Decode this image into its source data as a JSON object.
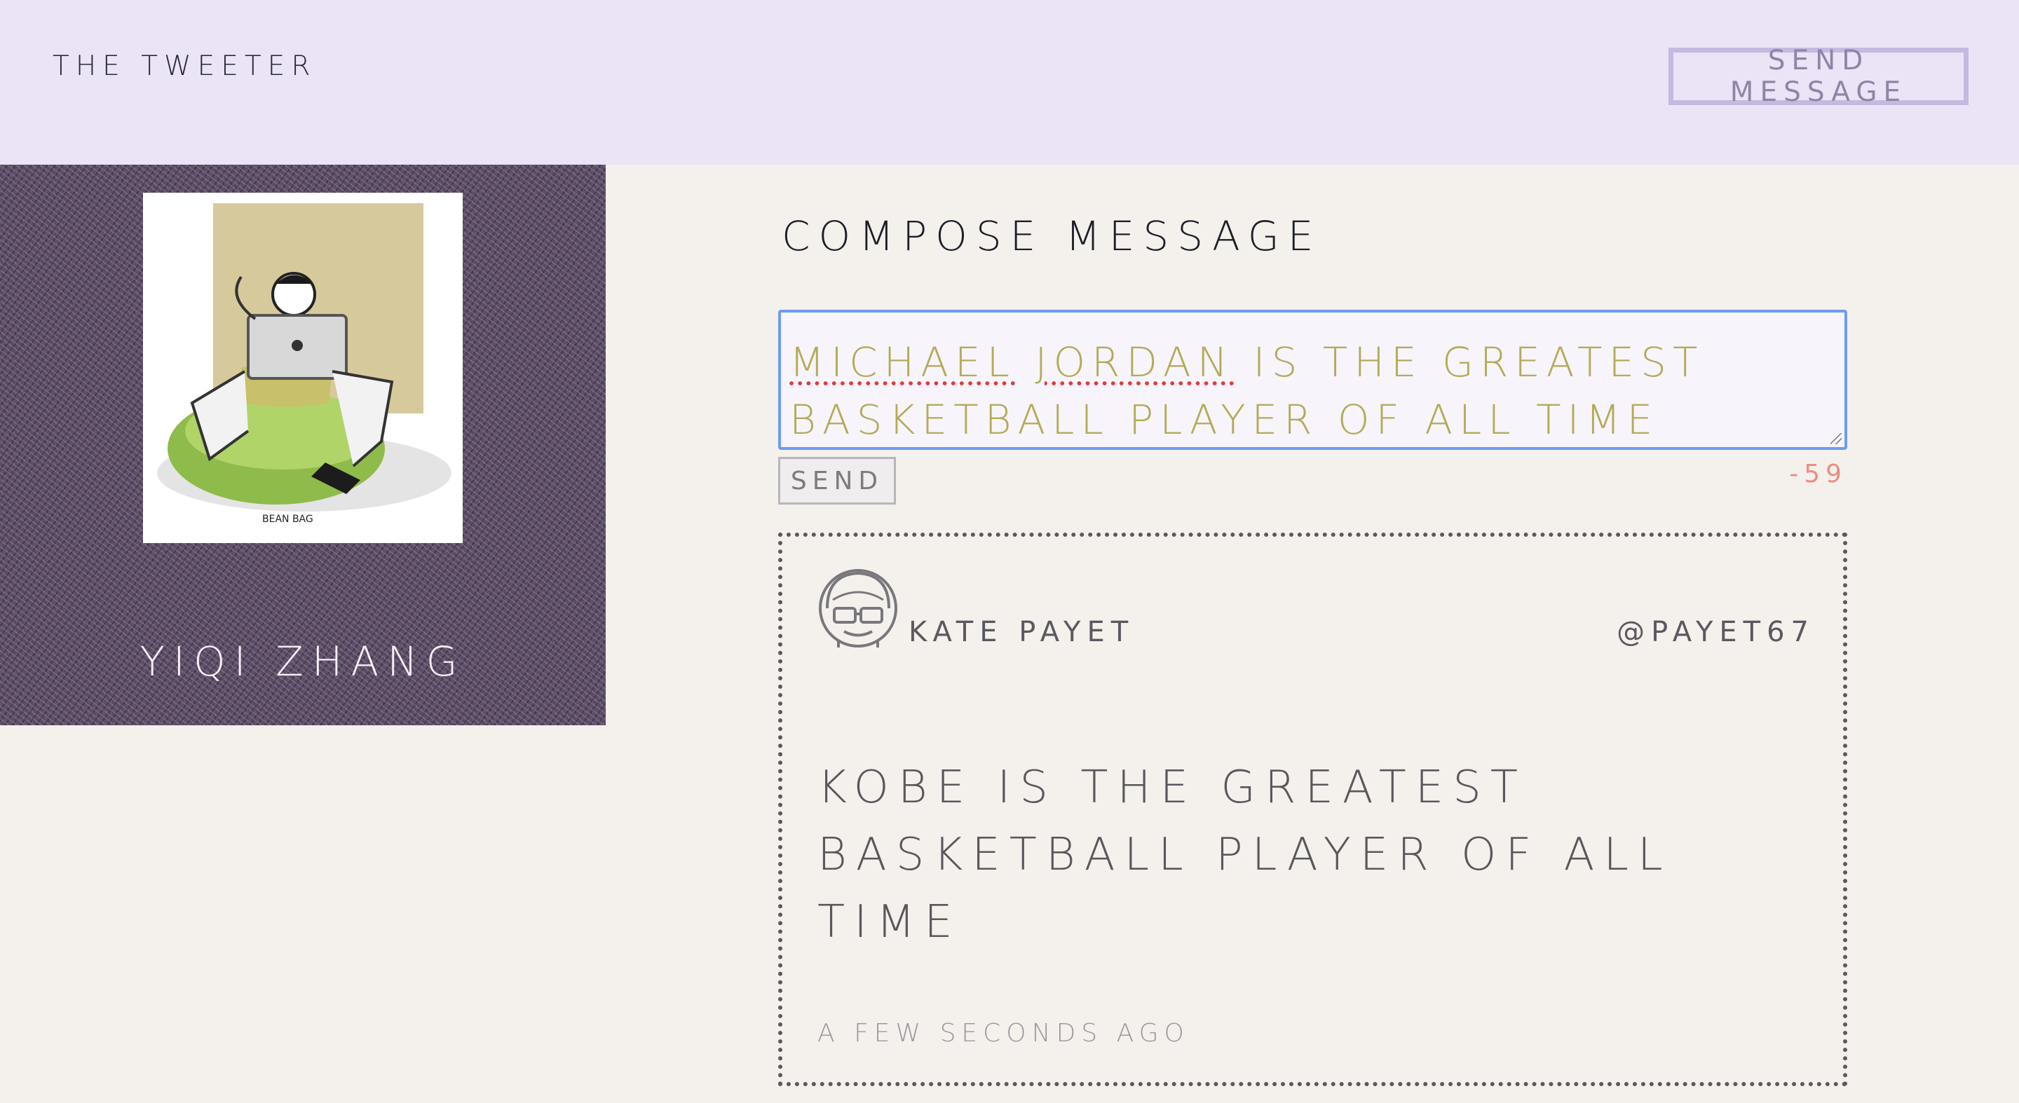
{
  "header": {
    "brand": "THE TWEETER",
    "send_message_label": "SEND MESSAGE"
  },
  "sidebar": {
    "profile_name": "YIQI ZHANG",
    "profile_image": "illustration-person-with-laptop-on-beanbag"
  },
  "compose": {
    "title": "COMPOSE MESSAGE",
    "text_words": [
      "MICHAEL",
      "JORDAN",
      "IS THE GREATEST BASKETBALL PLAYER OF ALL TIME"
    ],
    "send_label": "SEND",
    "char_count": "-59"
  },
  "tweet": {
    "author_name": "KATE PAYET",
    "author_handle": "@PAYET67",
    "text": "KOBE IS THE GREATEST BASKETBALL PLAYER OF ALL TIME",
    "timestamp": "A FEW SECONDS AGO",
    "avatar_icon": "avatar-with-sunglasses-icon"
  },
  "colors": {
    "header_bg": "#ebe4f6",
    "page_bg": "#f4f1ed",
    "sidebar_bg": "#5b4d64",
    "compose_text": "#b3ab57",
    "char_count": "#ee8d7e",
    "focus_border": "#6e9cf0"
  }
}
